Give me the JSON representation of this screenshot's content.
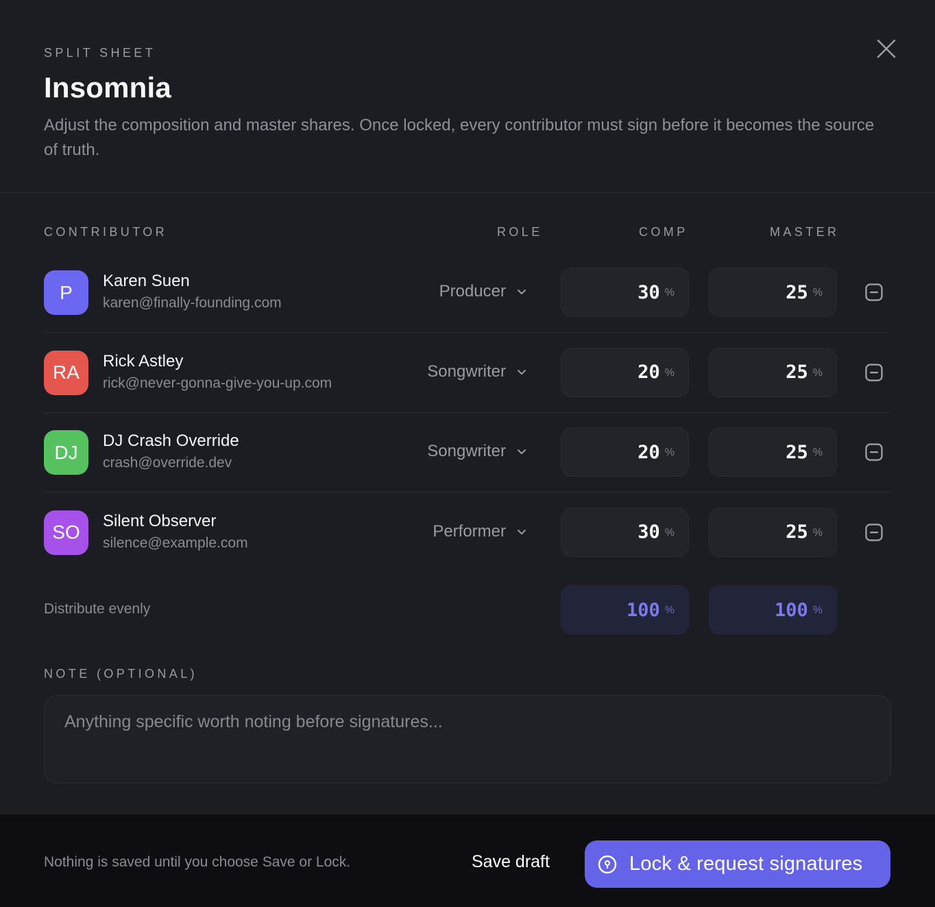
{
  "header": {
    "eyebrow": "SPLIT SHEET",
    "title": "Insomnia",
    "description": "Adjust the composition and master shares. Once locked, every contributor must sign before it becomes the source of truth.",
    "close_icon": "close-icon"
  },
  "table": {
    "columns": {
      "contributor": "CONTRIBUTOR",
      "role": "ROLE",
      "comp": "COMP",
      "master": "MASTER"
    },
    "percent_sign": "%",
    "rows": [
      {
        "initials": "P",
        "avatar_color": "#6b67f0",
        "name": "Karen Suen",
        "email": "karen@finally-founding.com",
        "role": "Producer",
        "comp": "30",
        "master": "25"
      },
      {
        "initials": "RA",
        "avatar_color": "#e5564e",
        "name": "Rick Astley",
        "email": "rick@never-gonna-give-you-up.com",
        "role": "Songwriter",
        "comp": "20",
        "master": "25"
      },
      {
        "initials": "DJ",
        "avatar_color": "#55c25f",
        "name": "DJ Crash Override",
        "email": "crash@override.dev",
        "role": "Songwriter",
        "comp": "20",
        "master": "25"
      },
      {
        "initials": "SO",
        "avatar_color": "#a652ea",
        "name": "Silent Observer",
        "email": "silence@example.com",
        "role": "Performer",
        "comp": "30",
        "master": "25"
      }
    ],
    "distribute_label": "Distribute evenly",
    "totals": {
      "comp": "100",
      "master": "100"
    }
  },
  "note": {
    "label": "NOTE (OPTIONAL)",
    "placeholder": "Anything specific worth noting before signatures...",
    "value": ""
  },
  "footer": {
    "hint": "Nothing is saved until you choose Save or Lock.",
    "save_draft_label": "Save draft",
    "lock_label": "Lock & request signatures",
    "lock_icon": "lock-keyhole-icon"
  },
  "colors": {
    "accent": "#6563e8",
    "total_text": "#7b79f0",
    "background": "#1c1d22",
    "footer_background": "#0e0e12"
  }
}
